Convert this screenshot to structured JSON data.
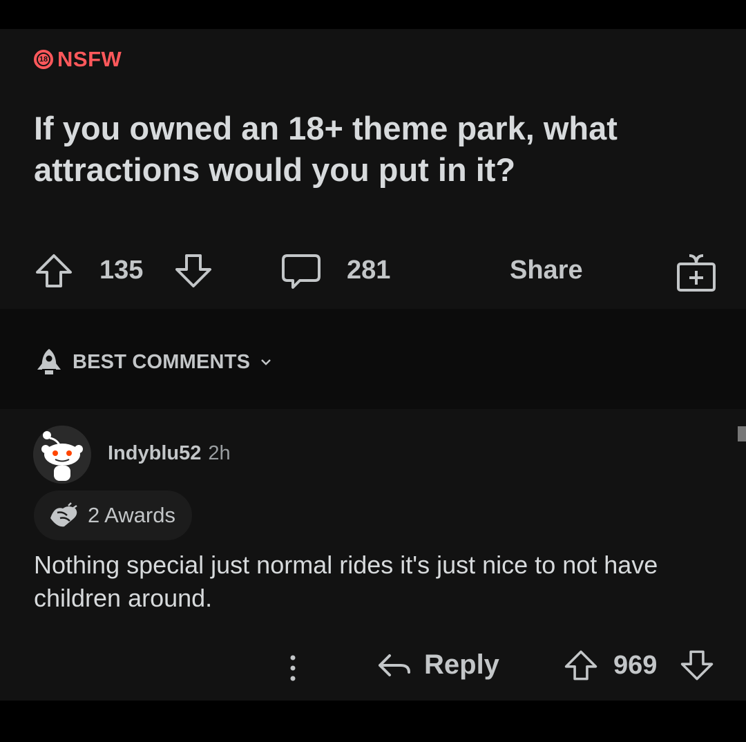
{
  "post": {
    "nsfw_badge": "18",
    "nsfw_label": "NSFW",
    "title": "If you owned an 18+ theme park, what attractions would you put in it?",
    "upvotes": "135",
    "comments": "281",
    "share_label": "Share"
  },
  "sort": {
    "label": "BEST COMMENTS"
  },
  "comment": {
    "username": "Indyblu52",
    "time": "2h",
    "awards_label": "2 Awards",
    "body": "Nothing special just normal rides it's just nice to not have children around.",
    "reply_label": "Reply",
    "votes": "969"
  },
  "colors": {
    "background": "#121212",
    "nsfw": "#ff585b",
    "text": "#d7dadc",
    "muted": "#c3c6c8"
  }
}
